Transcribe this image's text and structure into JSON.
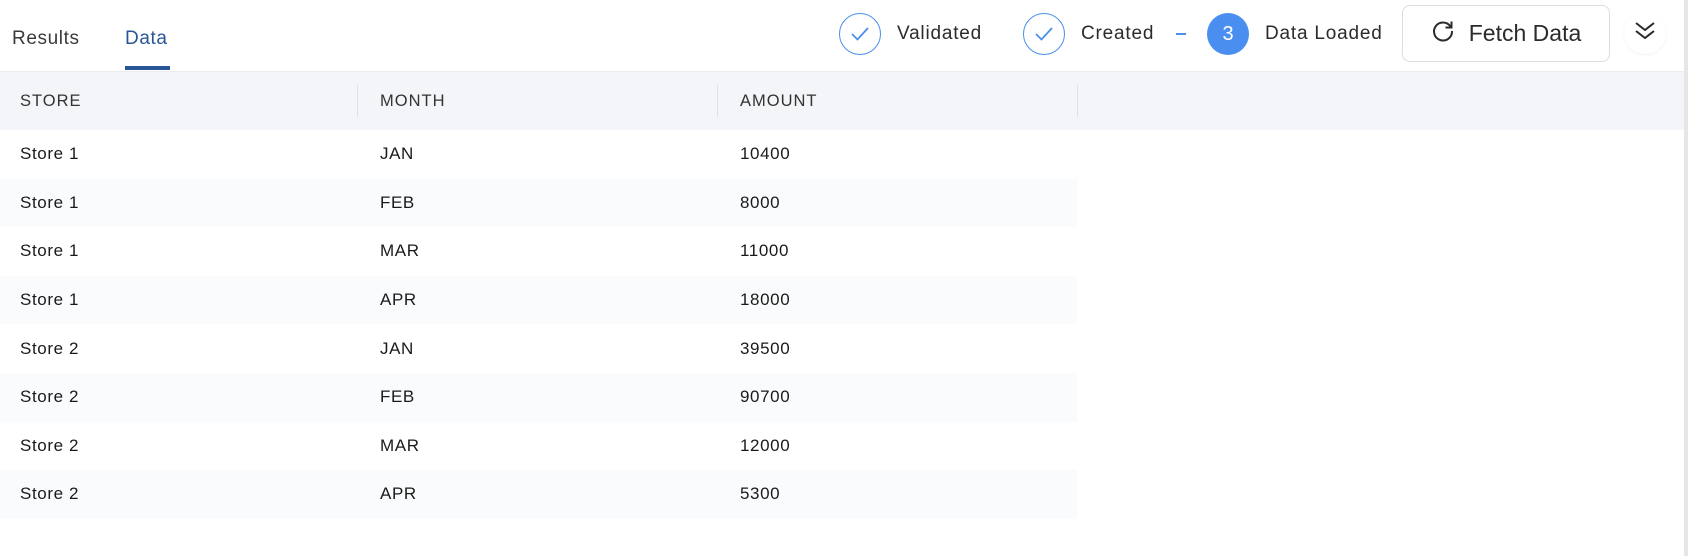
{
  "tabs": [
    {
      "label": "Results",
      "active": false
    },
    {
      "label": "Data",
      "active": true
    }
  ],
  "steps": [
    {
      "label": "Validated",
      "state": "done",
      "icon": "check-icon"
    },
    {
      "label": "Created",
      "state": "done",
      "icon": "check-icon"
    },
    {
      "label": "Data Loaded",
      "state": "active",
      "number": "3"
    }
  ],
  "step_separator": "-",
  "fetch_button": {
    "label": "Fetch Data",
    "icon": "refresh-icon"
  },
  "expand_button": {
    "icon": "double-chevron-down-icon"
  },
  "colors": {
    "accent": "#4a8ff0",
    "tab_active": "#2a5697",
    "header_bg": "#f4f5f9"
  },
  "table": {
    "columns": [
      "STORE",
      "MONTH",
      "AMOUNT"
    ],
    "rows": [
      [
        "Store 1",
        "JAN",
        "10400"
      ],
      [
        "Store 1",
        "FEB",
        "8000"
      ],
      [
        "Store 1",
        "MAR",
        "11000"
      ],
      [
        "Store 1",
        "APR",
        "18000"
      ],
      [
        "Store 2",
        "JAN",
        "39500"
      ],
      [
        "Store 2",
        "FEB",
        "90700"
      ],
      [
        "Store 2",
        "MAR",
        "12000"
      ],
      [
        "Store 2",
        "APR",
        "5300"
      ]
    ]
  }
}
